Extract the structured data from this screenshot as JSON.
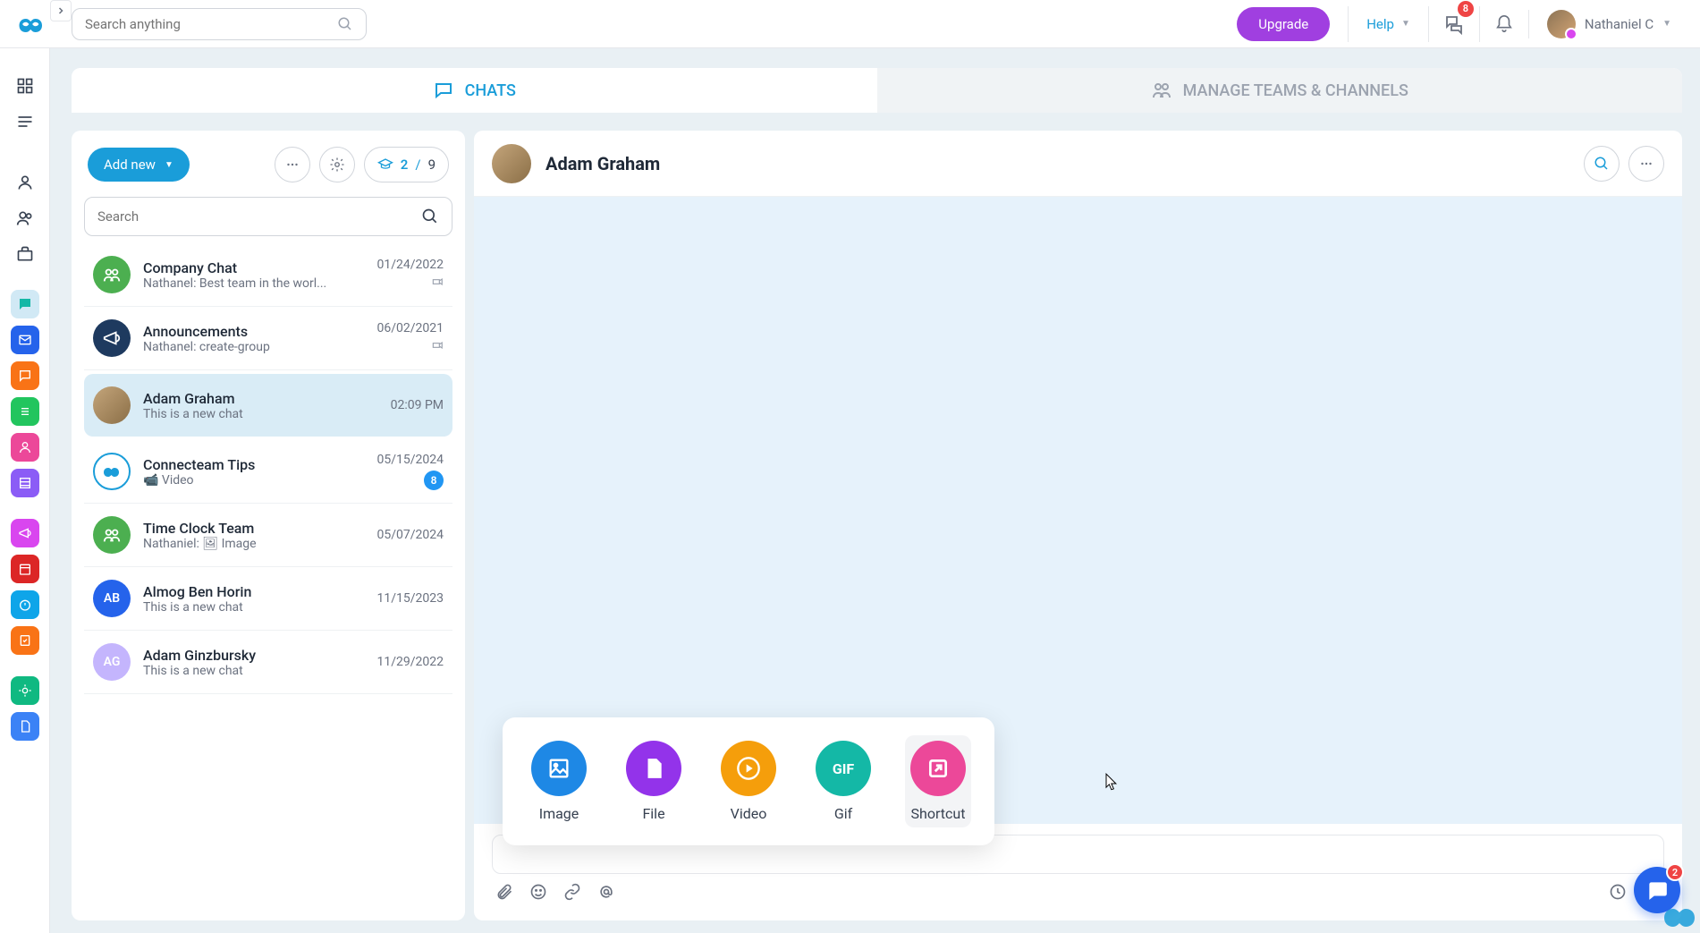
{
  "topbar": {
    "search_placeholder": "Search anything",
    "upgrade": "Upgrade",
    "help": "Help",
    "messages_badge": "8",
    "user_name": "Nathaniel C"
  },
  "tabs": {
    "chats": "CHATS",
    "manage": "MANAGE TEAMS & CHANNELS"
  },
  "chatlist": {
    "add_new": "Add new",
    "quota": {
      "used": "2",
      "sep": " / ",
      "total": "9"
    },
    "search_placeholder": "Search",
    "items": [
      {
        "title": "Company Chat",
        "preview": "Nathanel: Best team in the worl...",
        "date": "01/24/2022",
        "avatar_type": "green",
        "pinned": true
      },
      {
        "title": "Announcements",
        "preview": "Nathanel: create-group",
        "date": "06/02/2021",
        "avatar_type": "navy",
        "pinned": true
      },
      {
        "title": "Adam Graham",
        "preview": "This is a new chat",
        "date": "02:09 PM",
        "avatar_type": "photo",
        "active": true
      },
      {
        "title": "Connecteam Tips",
        "preview": "📹 Video",
        "date": "05/15/2024",
        "avatar_type": "ring",
        "badge": "8"
      },
      {
        "title": "Time Clock Team",
        "preview": "Nathaniel: 🖼 Image",
        "date": "05/07/2024",
        "avatar_type": "green"
      },
      {
        "title": "Almog Ben Horin",
        "preview": "This is a new chat",
        "date": "11/15/2023",
        "avatar_type": "blue",
        "initials": "AB"
      },
      {
        "title": "Adam Ginzbursky",
        "preview": "This is a new chat",
        "date": "11/29/2022",
        "avatar_type": "purple",
        "initials": "AG"
      }
    ]
  },
  "chatview": {
    "title": "Adam Graham"
  },
  "attach": {
    "items": [
      {
        "label": "Image",
        "color": "ac-blue",
        "icon": "image"
      },
      {
        "label": "File",
        "color": "ac-purple",
        "icon": "file"
      },
      {
        "label": "Video",
        "color": "ac-orange",
        "icon": "video"
      },
      {
        "label": "Gif",
        "color": "ac-teal",
        "icon": "gif"
      },
      {
        "label": "Shortcut",
        "color": "ac-pink",
        "icon": "shortcut",
        "hover": true
      }
    ]
  },
  "floating_badge": "2",
  "colors": {
    "accent": "#1a9dd9",
    "upgrade": "#a03fe0",
    "danger": "#ef4444"
  }
}
